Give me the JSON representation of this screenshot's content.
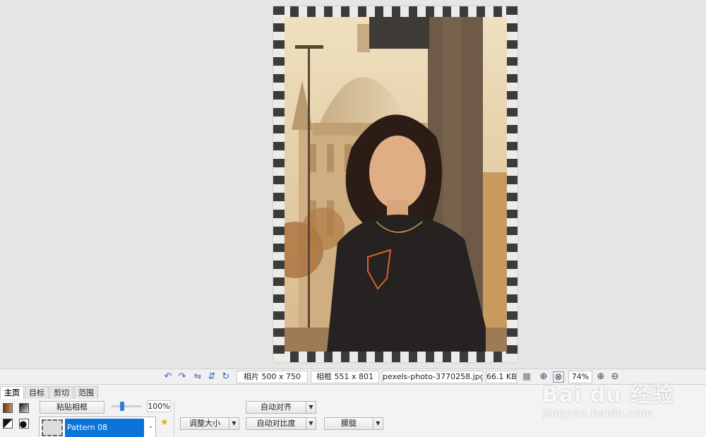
{
  "status_bar": {
    "photo_size": "相片 500 x 750",
    "frame_size": "相框 551 x 801",
    "filename": "pexels-photo-3770258.jpg",
    "filesize": "66.1 KB",
    "zoom": "74%"
  },
  "tabs": [
    {
      "label": "主页",
      "active": true
    },
    {
      "label": "目标"
    },
    {
      "label": "剪切"
    },
    {
      "label": "范围"
    }
  ],
  "toolbar": {
    "paste_frame": "粘贴相框",
    "opacity": "100%",
    "pattern_name": "Pattern 08",
    "resize": "调整大小",
    "auto_align": "自动对齐",
    "auto_contrast": "自动对比度",
    "menu_fragment": "朦胧"
  },
  "watermark": {
    "text": "Bai du 经验",
    "url": "jingyan.baidu.com"
  },
  "colors": {
    "accent": "#0a74d9",
    "frame_dark": "#3b3b3b",
    "frame_light": "#ecebe6"
  }
}
